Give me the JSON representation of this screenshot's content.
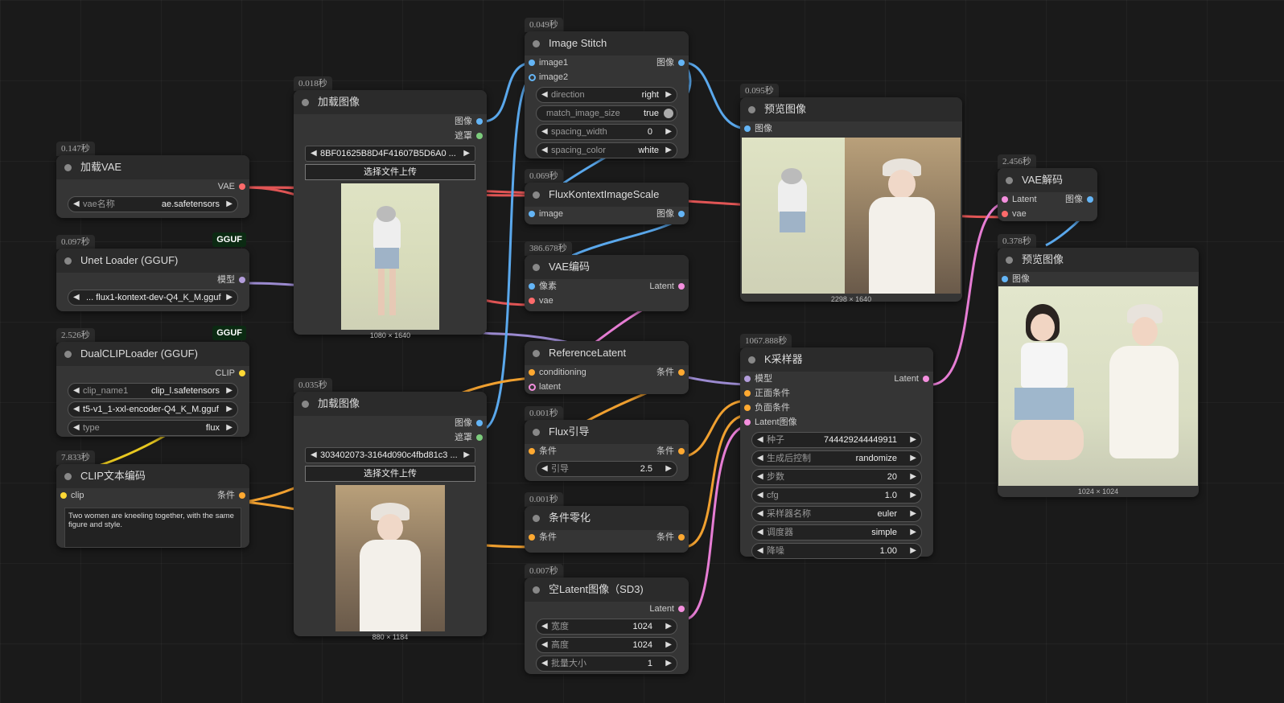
{
  "nodes": {
    "load_vae": {
      "time": "0.147秒",
      "title": "加载VAE",
      "out": "VAE",
      "widget_label": "vae名称",
      "widget_value": "ae.safetensors"
    },
    "unet": {
      "time": "0.097秒",
      "title": "Unet Loader (GGUF)",
      "badge": "GGUF",
      "out": "模型",
      "widget_value": "... flux1-kontext-dev-Q4_K_M.gguf"
    },
    "dualclip": {
      "time": "2.526秒",
      "title": "DualCLIPLoader (GGUF)",
      "badge": "GGUF",
      "out": "CLIP",
      "w1_label": "clip_name1",
      "w1_value": "clip_l.safetensors",
      "w2_value": "t5-v1_1-xxl-encoder-Q4_K_M.gguf",
      "w3_label": "type",
      "w3_value": "flux"
    },
    "clip_text": {
      "time": "7.833秒",
      "title": "CLIP文本编码",
      "in": "clip",
      "out": "条件",
      "text": "Two women are kneeling together, with the same figure and style."
    },
    "load_image1": {
      "time": "0.018秒",
      "title": "加载图像",
      "out1": "图像",
      "out2": "遮罩",
      "file": "8BF01625B8D4F41607B5D6A0 ...",
      "button": "选择文件上传",
      "caption": "1080 × 1640"
    },
    "load_image2": {
      "time": "0.035秒",
      "title": "加载图像",
      "out1": "图像",
      "out2": "遮罩",
      "file": "303402073-3164d090c4fbd81c3 ...",
      "button": "选择文件上传",
      "caption": "880 × 1184"
    },
    "stitch": {
      "time": "0.049秒",
      "title": "Image Stitch",
      "in1": "image1",
      "in2": "image2",
      "out": "图像",
      "w1_label": "direction",
      "w1_value": "right",
      "w2_label": "match_image_size",
      "w2_value": "true",
      "w3_label": "spacing_width",
      "w3_value": "0",
      "w4_label": "spacing_color",
      "w4_value": "white"
    },
    "scale": {
      "time": "0.069秒",
      "title": "FluxKontextImageScale",
      "in": "image",
      "out": "图像"
    },
    "vae_encode": {
      "time": "386.678秒",
      "title": "VAE编码",
      "in1": "像素",
      "in2": "vae",
      "out": "Latent"
    },
    "ref_latent": {
      "title": "ReferenceLatent",
      "in1": "conditioning",
      "in2": "latent",
      "out": "条件"
    },
    "flux_guide": {
      "time": "0.001秒",
      "title": "Flux引导",
      "in": "条件",
      "out": "条件",
      "w_label": "引导",
      "w_value": "2.5"
    },
    "cond_zero": {
      "time": "0.001秒",
      "title": "条件零化",
      "in": "条件",
      "out": "条件"
    },
    "empty_latent": {
      "time": "0.007秒",
      "title": "空Latent图像（SD3)",
      "out": "Latent",
      "w1_label": "宽度",
      "w1_value": "1024",
      "w2_label": "高度",
      "w2_value": "1024",
      "w3_label": "批量大小",
      "w3_value": "1"
    },
    "preview1": {
      "time": "0.095秒",
      "title": "预览图像",
      "in": "图像",
      "caption": "2298 × 1640"
    },
    "ksampler": {
      "time": "1067.888秒",
      "title": "K采样器",
      "in1": "模型",
      "in2": "正面条件",
      "in3": "负面条件",
      "in4": "Latent图像",
      "out": "Latent",
      "w1_label": "种子",
      "w1_value": "744429244449911",
      "w2_label": "生成后控制",
      "w2_value": "randomize",
      "w3_label": "步数",
      "w3_value": "20",
      "w4_label": "cfg",
      "w4_value": "1.0",
      "w5_label": "采样器名称",
      "w5_value": "euler",
      "w6_label": "调度器",
      "w6_value": "simple",
      "w7_label": "降噪",
      "w7_value": "1.00"
    },
    "vae_decode": {
      "time": "2.456秒",
      "title": "VAE解码",
      "in1": "Latent",
      "in2": "vae",
      "out": "图像"
    },
    "preview2": {
      "time": "0.378秒",
      "title": "预览图像",
      "in": "图像",
      "caption": "1024 × 1024"
    }
  },
  "colors": {
    "image": "#64b5f6",
    "vae": "#ff6b6b",
    "model": "#b39ddb",
    "clip": "#fdd835",
    "cond": "#ffa931",
    "latent": "#f48fde",
    "mask": "#7ccc7c"
  }
}
